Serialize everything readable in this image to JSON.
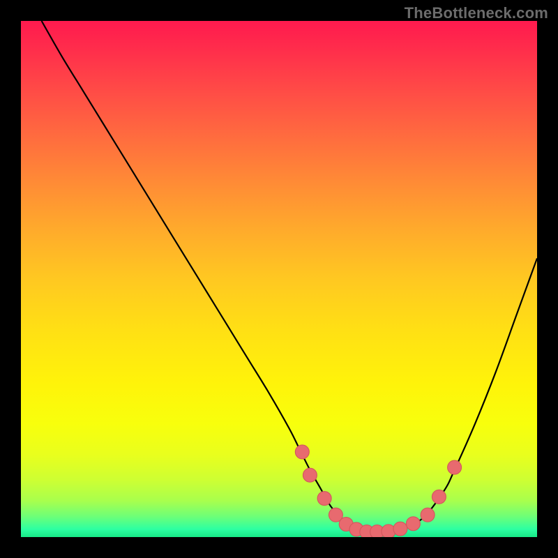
{
  "watermark": "TheBottleneck.com",
  "colors": {
    "page_bg": "#000000",
    "curve": "#000000",
    "marker_fill": "#e86a6f",
    "marker_stroke": "#d2575c",
    "watermark": "#6c6c6c"
  },
  "chart_data": {
    "type": "line",
    "title": "",
    "xlabel": "",
    "ylabel": "",
    "xlim": [
      0,
      100
    ],
    "ylim": [
      0,
      100
    ],
    "grid": false,
    "legend": false,
    "series": [
      {
        "name": "bottleneck-curve",
        "x": [
          4,
          8,
          12,
          16,
          20,
          24,
          28,
          32,
          36,
          40,
          44,
          48,
          52,
          54,
          56,
          58,
          60,
          62,
          64,
          66,
          68,
          70,
          74,
          78,
          82,
          84,
          88,
          92,
          96,
          100
        ],
        "y": [
          100,
          93,
          86.5,
          80,
          73.5,
          67,
          60.5,
          54,
          47.5,
          41,
          34.5,
          28,
          21,
          17,
          13,
          9.5,
          6,
          3.8,
          2.3,
          1.4,
          1.0,
          1.0,
          1.6,
          3.8,
          9,
          13,
          22,
          32,
          43,
          54
        ]
      }
    ],
    "markers": [
      {
        "x": 54.5,
        "y": 16.5
      },
      {
        "x": 56.0,
        "y": 12.0
      },
      {
        "x": 58.8,
        "y": 7.5
      },
      {
        "x": 61.0,
        "y": 4.3
      },
      {
        "x": 63.0,
        "y": 2.5
      },
      {
        "x": 65.0,
        "y": 1.5
      },
      {
        "x": 67.0,
        "y": 1.0
      },
      {
        "x": 69.0,
        "y": 1.0
      },
      {
        "x": 71.2,
        "y": 1.1
      },
      {
        "x": 73.5,
        "y": 1.6
      },
      {
        "x": 76.0,
        "y": 2.6
      },
      {
        "x": 78.8,
        "y": 4.3
      },
      {
        "x": 81.0,
        "y": 7.8
      },
      {
        "x": 84.0,
        "y": 13.5
      }
    ]
  }
}
